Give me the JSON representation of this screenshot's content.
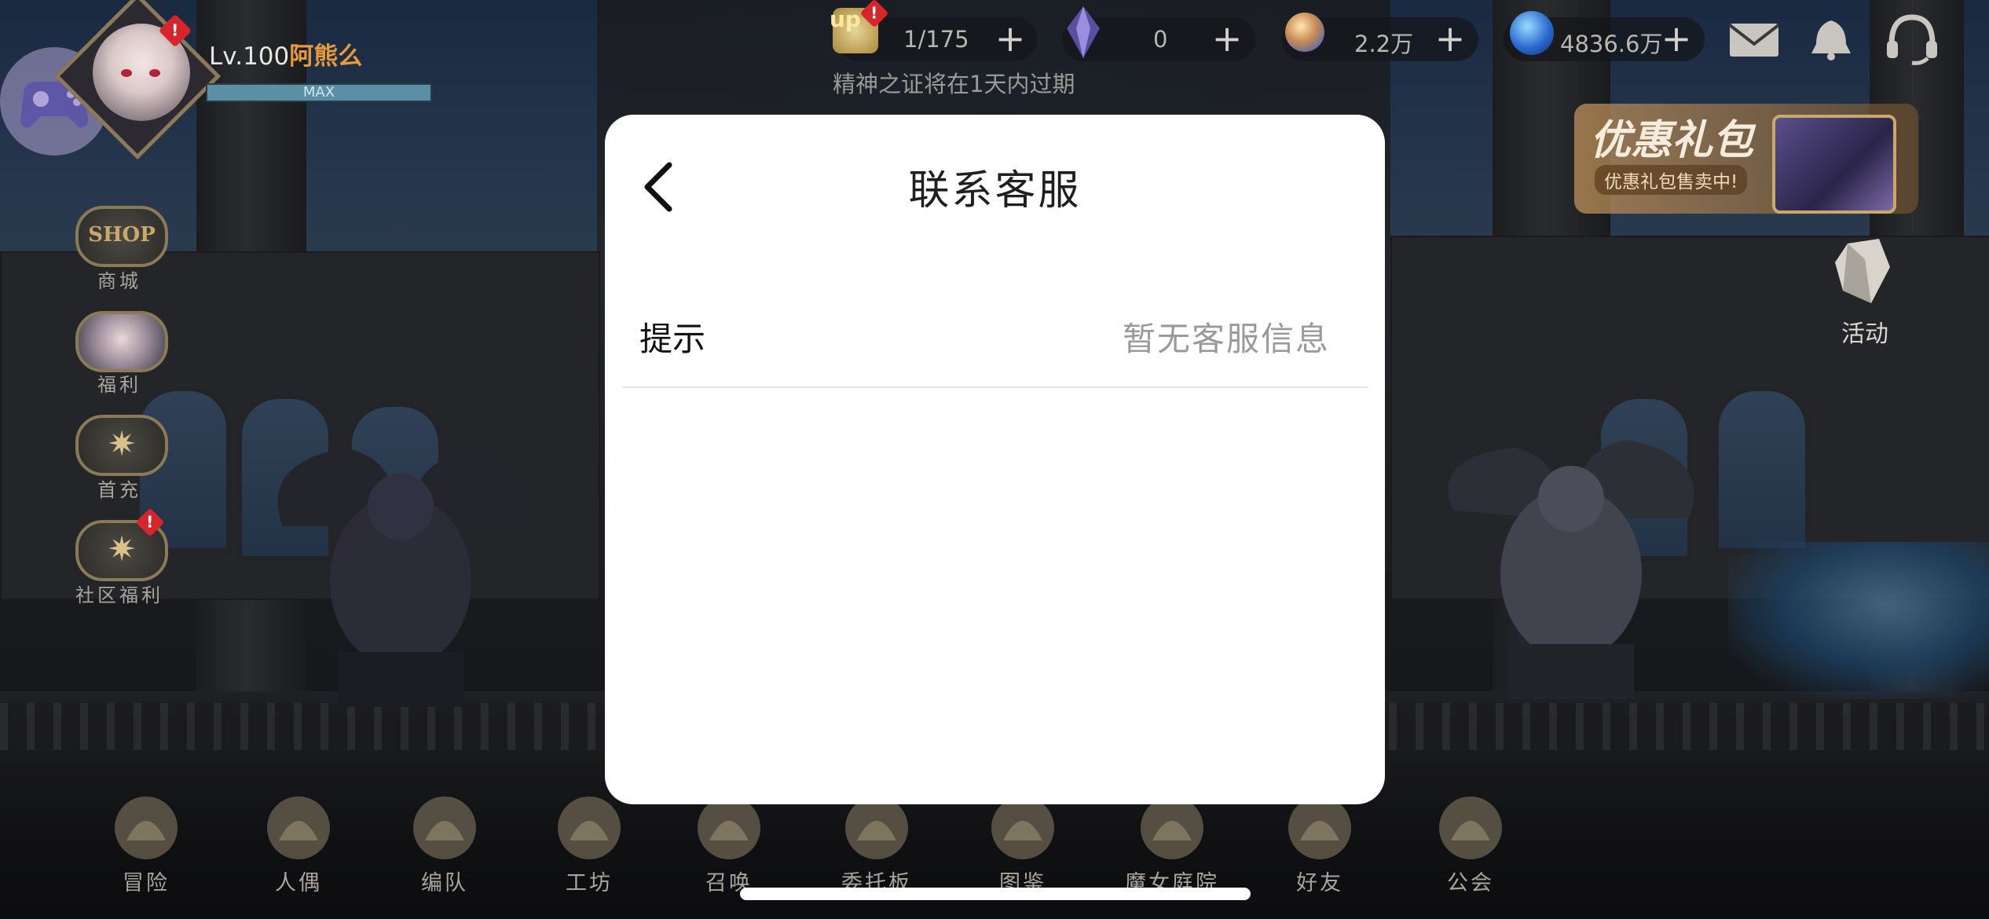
{
  "player": {
    "level": "Lv.100",
    "name": "阿熊么",
    "exp_label": "MAX"
  },
  "resources": {
    "stamina": "1/175",
    "stamina_badge": "up",
    "crystal": "0",
    "gem": "2.2万",
    "gold": "4836.6万",
    "expire_notice": "精神之证将在1天内过期",
    "badge_mark": "!"
  },
  "side_menu": {
    "shop_badge_text": "SHOP",
    "items": [
      {
        "label": "商城"
      },
      {
        "label": "福利"
      },
      {
        "label": "首充"
      },
      {
        "label": "社区福利"
      }
    ]
  },
  "promo": {
    "title": "优惠礼包",
    "subtitle": "优惠礼包售卖中!"
  },
  "activity": {
    "label": "活动"
  },
  "bottom_nav": [
    {
      "label": "冒险"
    },
    {
      "label": "人偶"
    },
    {
      "label": "编队"
    },
    {
      "label": "工坊"
    },
    {
      "label": "召唤"
    },
    {
      "label": "委托板"
    },
    {
      "label": "图鉴"
    },
    {
      "label": "魔女庭院"
    },
    {
      "label": "好友"
    },
    {
      "label": "公会"
    }
  ],
  "modal": {
    "title": "联系客服",
    "row_label": "提示",
    "row_value": "暂无客服信息"
  },
  "icons": {
    "back": "chevron-left-icon",
    "mail": "mail-icon",
    "notification": "bell-icon",
    "support": "headset-icon",
    "controller": "gamepad-icon"
  },
  "colors": {
    "modal_bg": "#ffffff",
    "player_name": "#e69a3a",
    "badge_red": "#d7262b",
    "exp_bar": "#5a8fa6"
  }
}
